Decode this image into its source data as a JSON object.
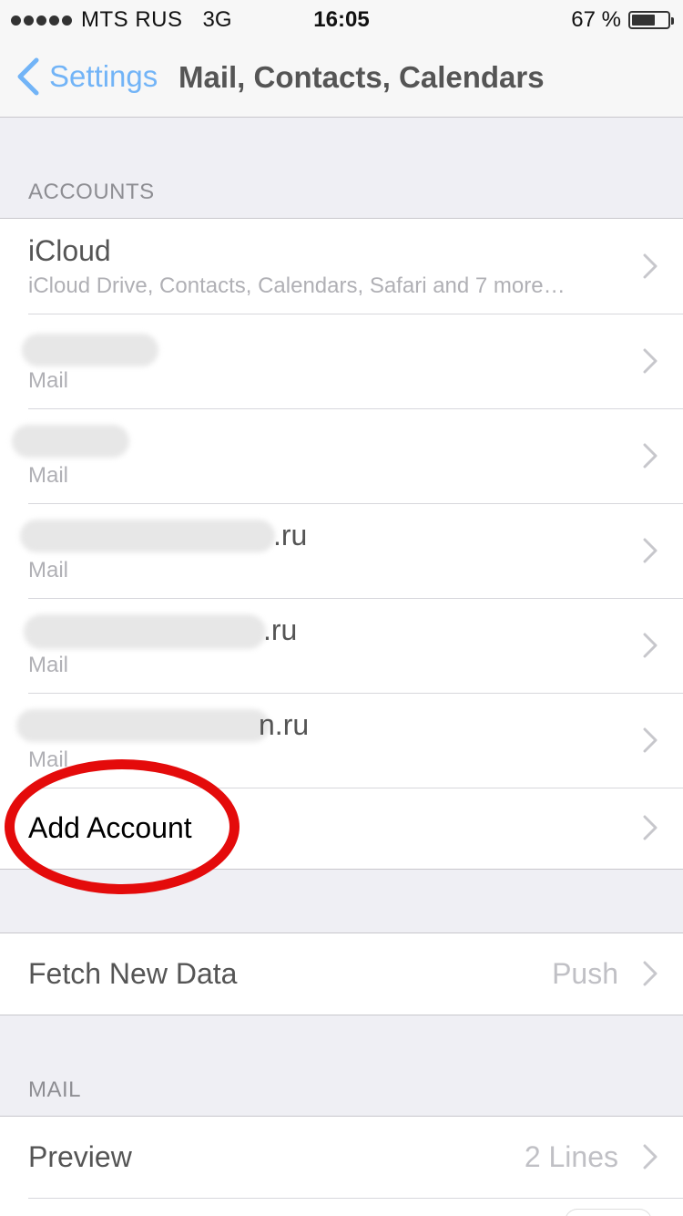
{
  "status": {
    "carrier": "MTS RUS",
    "network": "3G",
    "time": "16:05",
    "battery_text": "67 %",
    "battery_level": 0.67
  },
  "nav": {
    "back_label": "Settings",
    "title": "Mail, Contacts, Calendars"
  },
  "accounts": {
    "header": "ACCOUNTS",
    "items": [
      {
        "title": "iCloud",
        "subtitle": "iCloud Drive, Contacts, Calendars, Safari and 7 more…"
      },
      {
        "title": "",
        "subtitle": "Mail"
      },
      {
        "title": "",
        "subtitle": "Mail"
      },
      {
        "title": ".ru",
        "subtitle": "Mail"
      },
      {
        "title": ".ru",
        "subtitle": "Mail"
      },
      {
        "title": "n.ru",
        "subtitle": "Mail"
      }
    ],
    "add_account": "Add Account"
  },
  "fetch": {
    "label": "Fetch New Data",
    "value": "Push"
  },
  "mail": {
    "header": "MAIL",
    "preview_label": "Preview",
    "preview_value": "2 Lines"
  },
  "colors": {
    "accent": "#72b4f7",
    "annotation": "#e40b0b"
  }
}
